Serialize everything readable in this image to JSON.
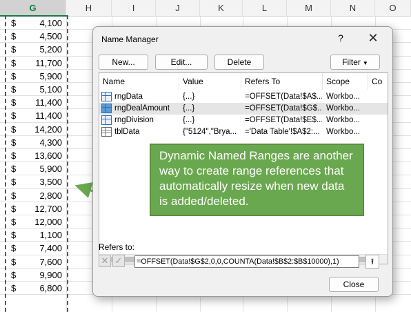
{
  "sheet": {
    "columns": [
      "G",
      "H",
      "I",
      "J",
      "K",
      "L",
      "M",
      "N",
      "O"
    ],
    "selected_column": "G",
    "currency_symbol": "$",
    "values": [
      "4,100",
      "4,500",
      "5,200",
      "11,700",
      "5,900",
      "5,100",
      "11,400",
      "11,400",
      "14,200",
      "4,300",
      "13,600",
      "5,900",
      "3,500",
      "2,800",
      "12,700",
      "12,000",
      "1,100",
      "7,400",
      "7,600",
      "9,900",
      "6,800"
    ],
    "marquee_color": "#217346"
  },
  "dialog": {
    "title": "Name Manager",
    "help": "?",
    "close_x": "✕",
    "buttons": {
      "new": "New...",
      "edit": "Edit...",
      "delete": "Delete",
      "filter": "Filter"
    },
    "columns": [
      "Name",
      "Value",
      "Refers To",
      "Scope",
      "Co"
    ],
    "rows": [
      {
        "icon": "range-icon",
        "name": "rngData",
        "value": "{...}",
        "refers_to": "=OFFSET(Data!$A$...",
        "scope": "Workbo..."
      },
      {
        "icon": "range-icon",
        "name": "rngDealAmount",
        "value": "{...}",
        "refers_to": "=OFFSET(Data!$G$...",
        "scope": "Workbo...",
        "selected": true
      },
      {
        "icon": "range-icon",
        "name": "rngDivision",
        "value": "{...}",
        "refers_to": "=OFFSET(Data!$E$...",
        "scope": "Workbo..."
      },
      {
        "icon": "table-icon",
        "name": "tblData",
        "value": "{\"5124\",\"Brya...",
        "refers_to": "='Data Table'!$A$2:...",
        "scope": "Workbo..."
      }
    ],
    "refers_label": "Refers to:",
    "formula": "=OFFSET(Data!$G$2,0,0,COUNTA(Data!$B$2:$B$10000),1)",
    "close_button": "Close"
  },
  "callout": {
    "text": "Dynamic Named Ranges are another way to create range references that automatically resize when new data is added/deleted.",
    "fill": "#6aa84f"
  }
}
